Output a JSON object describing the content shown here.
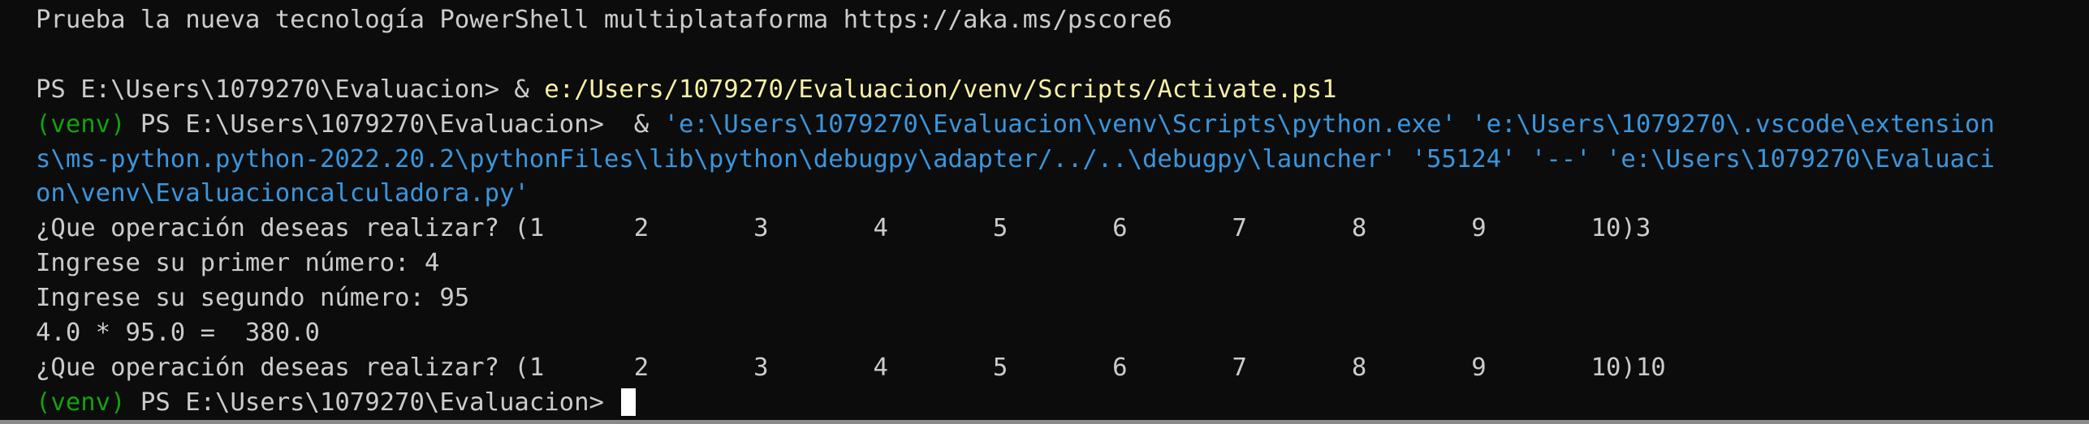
{
  "terminal": {
    "banner": "Prueba la nueva tecnología PowerShell multiplataforma https://aka.ms/pscore6",
    "prompt1": "PS E:\\Users\\1079270\\Evaluacion> ",
    "amp1": "& ",
    "activate_path": "e:/Users/1079270/Evaluacion/venv/Scripts/Activate.ps1",
    "venv_tag": "(venv)",
    "prompt2": " PS E:\\Users\\1079270\\Evaluacion>  & ",
    "cmd_line1": "'e:\\Users\\1079270\\Evaluacion\\venv\\Scripts\\python.exe' 'e:\\Users\\1079270\\.vscode\\extension",
    "cmd_line2": "s\\ms-python.python-2022.20.2\\pythonFiles\\lib\\python\\debugpy\\adapter/../..\\debugpy\\launcher' '55124' '--' 'e:\\Users\\1079270\\Evaluaci",
    "cmd_line3": "on\\venv\\Evaluacioncalculadora.py'",
    "menu_line1": "¿Que operación deseas realizar? (1      2       3       4       5       6       7       8       9       10)3",
    "input_first": "Ingrese su primer número: 4",
    "input_second": "Ingrese su segundo número: 95",
    "result": "4.0 * 95.0 =  380.0",
    "menu_line2": "¿Que operación deseas realizar? (1      2       3       4       5       6       7       8       9       10)10",
    "final_venv": "(venv)",
    "final_prompt": " PS E:\\Users\\1079270\\Evaluacion> "
  },
  "colors": {
    "background": "#0c0c0c",
    "foreground": "#cccccc",
    "venv": "#13a10e",
    "path_yellow": "#f9f1a5",
    "string_cyan": "#3a96dd"
  }
}
